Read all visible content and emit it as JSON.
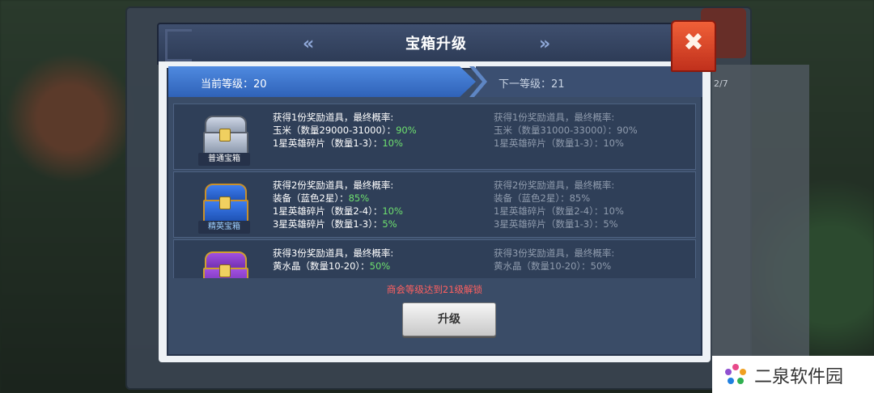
{
  "background": {
    "page_fraction": "2/7"
  },
  "title": "宝箱升级",
  "nav": {
    "prev": "«",
    "next": "»"
  },
  "level": {
    "current": "当前等级：20",
    "next": "下一等级：21"
  },
  "rows": [
    {
      "chest_label": "普通宝箱",
      "current": {
        "head": "获得1份奖励道具，最终概率:",
        "l1": "玉米（数量29000-31000）：",
        "p1": "90%",
        "l2": "1星英雄碎片（数量1-3）：",
        "p2": "10%"
      },
      "next": {
        "head": "获得1份奖励道具，最终概率:",
        "l1": "玉米（数量31000-33000）：",
        "p1": "90%",
        "l2": "1星英雄碎片（数量1-3）：",
        "p2": "10%"
      }
    },
    {
      "chest_label": "精英宝箱",
      "current": {
        "head": "获得2份奖励道具，最终概率:",
        "l1": "装备（蓝色2星）：",
        "p1": "85%",
        "l2": "1星英雄碎片（数量2-4）：",
        "p2": "10%",
        "l3": "3星英雄碎片（数量1-3）：",
        "p3": "5%"
      },
      "next": {
        "head": "获得2份奖励道具，最终概率:",
        "l1": "装备（蓝色2星）：",
        "p1": "85%",
        "l2": "1星英雄碎片（数量2-4）：",
        "p2": "10%",
        "l3": "3星英雄碎片（数量1-3）：",
        "p3": "5%"
      }
    },
    {
      "current": {
        "head": "获得3份奖励道具，最终概率:",
        "l1": "黄水晶（数量10-20）：",
        "p1": "50%"
      },
      "next": {
        "head": "获得3份奖励道具，最终概率:",
        "l1": "黄水晶（数量10-20）：",
        "p1": "50%"
      }
    }
  ],
  "unlock_text": "商会等级达到21级解锁",
  "upgrade_label": "升级",
  "close_icon": "✖",
  "watermark": "二泉软件园",
  "colors": {
    "highlight_green": "#6ee06e",
    "unlock_red": "#ff6060",
    "level_blue": "#2f62b8"
  }
}
